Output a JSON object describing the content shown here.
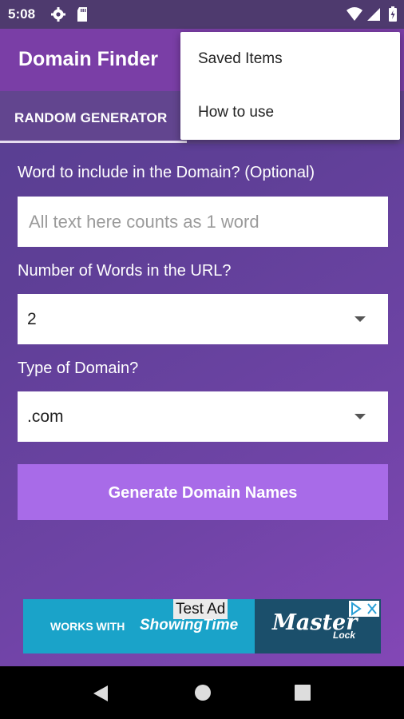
{
  "status_bar": {
    "time": "5:08",
    "icons": [
      "gear-icon",
      "sd-card-icon",
      "wifi-icon",
      "signal-icon",
      "battery-icon"
    ]
  },
  "app_bar": {
    "title": "Domain Finder"
  },
  "tabs": [
    {
      "label": "RANDOM GENERATOR",
      "selected": true
    }
  ],
  "overflow_menu": {
    "items": [
      {
        "label": "Saved Items"
      },
      {
        "label": "How to use"
      }
    ]
  },
  "form": {
    "word_label": "Word to include in the Domain? (Optional)",
    "word_placeholder": "All text here counts as 1 word",
    "word_value": "",
    "num_words_label": "Number of Words in the URL?",
    "num_words_value": "2",
    "domain_type_label": "Type of Domain?",
    "domain_type_value": ".com",
    "generate_label": "Generate Domain Names"
  },
  "ad": {
    "badge": "Test Ad",
    "works_with": "WORKS WITH",
    "showing_time": "ShowingTime",
    "brand": "Master",
    "brand_sub": "Lock"
  },
  "colors": {
    "app_bar": "#7a3ea6",
    "tab_bar": "#62458f",
    "button": "#a86be8",
    "background_start": "#553f8f",
    "background_end": "#8347b6"
  },
  "nav_bar": {
    "icons": [
      "back-icon",
      "home-icon",
      "recents-icon"
    ]
  }
}
